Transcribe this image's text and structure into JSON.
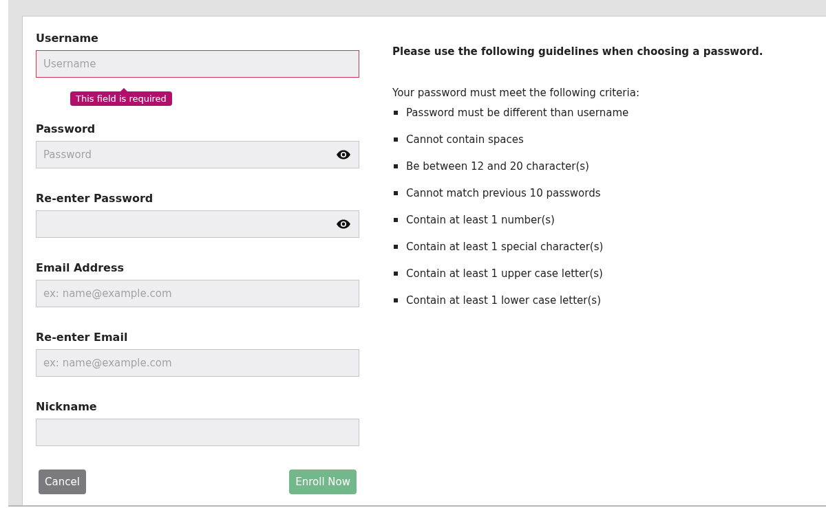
{
  "fields": [
    {
      "label": "Username",
      "kind": "text",
      "placeholder": "Username",
      "invalid": true,
      "error": "This field is required"
    },
    {
      "label": "Password",
      "kind": "password",
      "placeholder": "Password",
      "invalid": false
    },
    {
      "label": "Re-enter Password",
      "kind": "password",
      "invalid": false
    },
    {
      "label": "Email Address",
      "kind": "text",
      "placeholder": "ex: name@example.com",
      "invalid": false
    },
    {
      "label": "Re-enter Email",
      "kind": "text",
      "placeholder": "ex: name@example.com",
      "invalid": false
    },
    {
      "label": "Nickname",
      "kind": "text",
      "invalid": false
    }
  ],
  "buttons": [
    {
      "label": "Cancel",
      "kind": "secondary"
    },
    {
      "label": "Enroll Now",
      "kind": "primary",
      "disabled": true
    }
  ],
  "guidelines": {
    "heading": "Please use the following guidelines when choosing a password.",
    "intro": "Your password must meet the following criteria:",
    "criteria": [
      "Password must be different than username",
      "Cannot contain spaces",
      "Be between 12 and 20 character(s)",
      "Cannot match previous 10 passwords",
      "Contain at least 1 number(s)",
      "Contain at least 1 special character(s)",
      "Contain at least 1 upper case letter(s)",
      "Contain at least 1 lower case letter(s)"
    ]
  }
}
